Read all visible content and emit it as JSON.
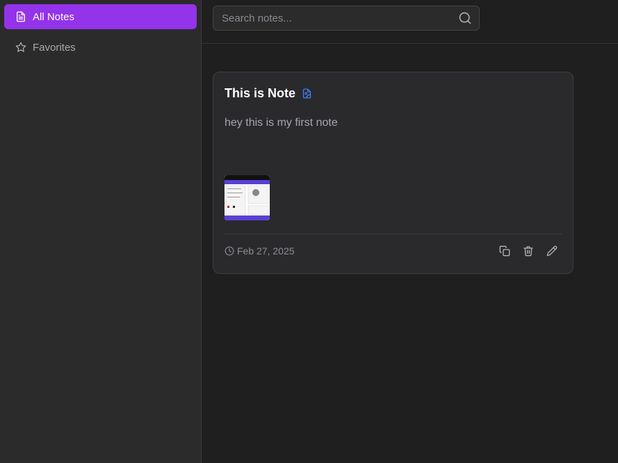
{
  "sidebar": {
    "items": [
      {
        "label": "All Notes",
        "icon": "document-icon",
        "active": true
      },
      {
        "label": "Favorites",
        "icon": "star-icon",
        "active": false
      }
    ]
  },
  "search": {
    "placeholder": "Search notes...",
    "value": ""
  },
  "notes": [
    {
      "title": "This is Note",
      "body": "hey this is my first note",
      "date": "Feb 27, 2025",
      "has_image": true
    }
  ],
  "colors": {
    "accent": "#9333ea",
    "background": "#1f1f1f",
    "sidebar": "#2b2b2b",
    "card": "#2a2a2c",
    "file_icon": "#3b82f6"
  }
}
